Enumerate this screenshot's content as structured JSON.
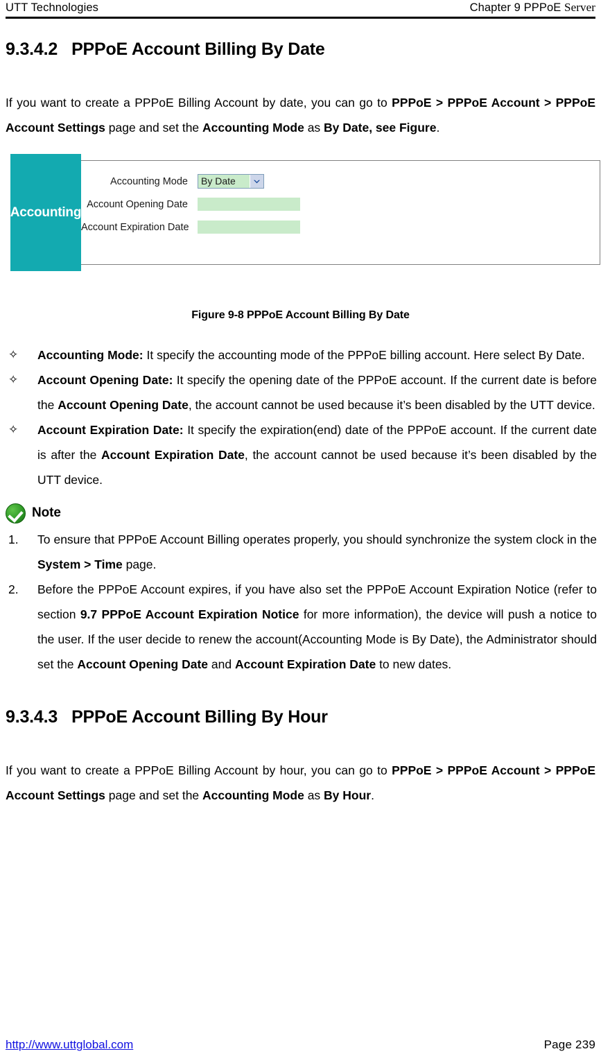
{
  "header": {
    "left": "UTT Technologies",
    "right_main": "Chapter 9 PPPoE ",
    "right_serif": "Server"
  },
  "section_1": {
    "number": "9.3.4.2",
    "title": "PPPoE Account Billing By Date",
    "intro": {
      "t1": "If you want to create a PPPoE Billing Account by date, you can go to ",
      "b1": "PPPoE > PPPoE Account > PPPoE Account Settings",
      "t2": " page and set the ",
      "b2": "Accounting Mode",
      "t3": " as ",
      "b3": "By Date, see Figure",
      "t4": "."
    }
  },
  "figure": {
    "sidebar_label": "Accounting",
    "rows": [
      {
        "label": "Accounting Mode",
        "control": "select",
        "value": "By Date",
        "arrow_icon": "chevron-down-icon"
      },
      {
        "label": "Account Opening Date",
        "control": "input",
        "value": ""
      },
      {
        "label": "Account Expiration Date",
        "control": "input",
        "value": ""
      }
    ],
    "caption": "Figure 9-8 PPPoE Account Billing By Date",
    "colors": {
      "sidebar": "#13aab0",
      "field": "#c9ebca",
      "select_border": "#7f9db9",
      "select_button": "#cdd6ea",
      "box_border": "#808080"
    }
  },
  "bullets": {
    "marker": "✧",
    "items": [
      {
        "b1": "Accounting Mode:",
        "t1": " It specify the accounting mode of the PPPoE billing account. Here select By Date."
      },
      {
        "b1": "Account Opening Date:",
        "t1": " It specify the opening date of the PPPoE account. If the current date is before the ",
        "b2": "Account Opening Date",
        "t2": ", the account cannot be used because it’s been disabled by the UTT device."
      },
      {
        "b1": "Account Expiration Date:",
        "t1": " It specify the expiration(end) date of the PPPoE account. If the current date is after the ",
        "b2": "Account Expiration Date",
        "t2": ", the account cannot be used because it’s been disabled by the UTT device."
      }
    ]
  },
  "note": {
    "icon": "green-check-circle-icon",
    "title": "Note",
    "items": [
      {
        "num": "1.",
        "t1": "To ensure that PPPoE Account Billing operates properly, you should synchronize the system clock in the ",
        "b1": "System > Time",
        "t2": " page."
      },
      {
        "num": "2.",
        "t1": "Before the PPPoE Account expires, if you have also set the PPPoE Account Expiration Notice (refer to section ",
        "b1": "9.7 PPPoE Account Expiration Notice",
        "t2": " for more information), the device will push a notice to the user. If the user decide to renew the account(Accounting Mode is By Date), the Administrator should set the ",
        "b2": "Account Opening Date",
        "t3": " and ",
        "b3": "Account Expiration Date",
        "t4": " to new dates."
      }
    ]
  },
  "section_2": {
    "number": "9.3.4.3",
    "title": "PPPoE Account Billing By Hour",
    "intro": {
      "t1": "If you want to create a PPPoE Billing Account by hour, you can go to ",
      "b1": "PPPoE > PPPoE Account > PPPoE Account Settings",
      "t2": " page and set the ",
      "b2": "Accounting Mode",
      "t3": " as ",
      "b3": "By Hour",
      "t4": "."
    }
  },
  "footer": {
    "url": "http://www.uttglobal.com",
    "page": "Page  239"
  }
}
